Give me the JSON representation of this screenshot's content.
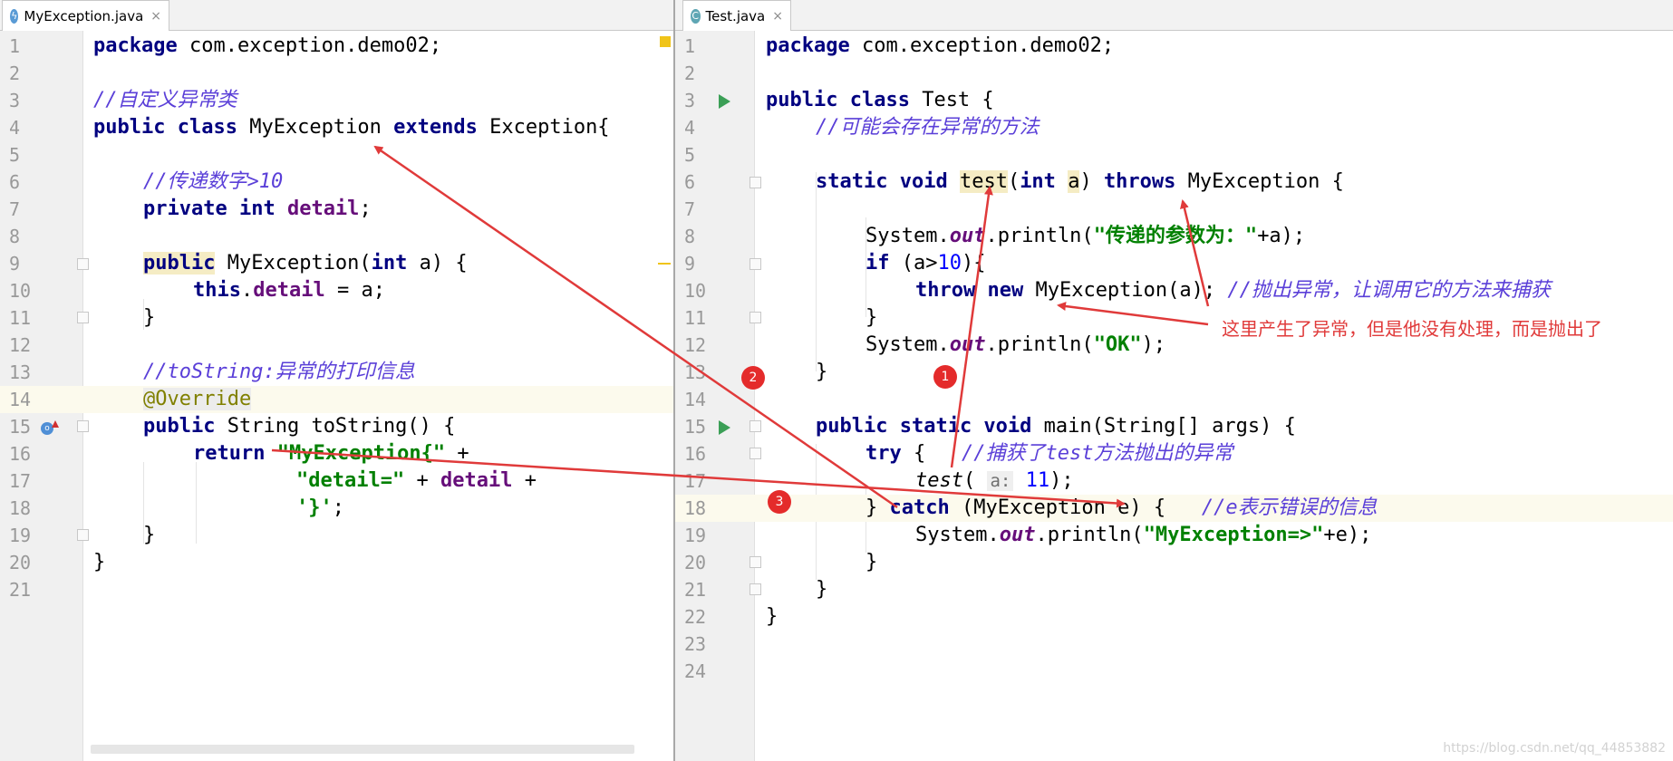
{
  "left_tab": {
    "label": "MyException.java",
    "icon": "exception-class-icon",
    "close": "×"
  },
  "right_tab": {
    "label": "Test.java",
    "icon": "class-icon",
    "close": "×"
  },
  "left_lines": [
    "1",
    "2",
    "3",
    "4",
    "5",
    "6",
    "7",
    "8",
    "9",
    "10",
    "11",
    "12",
    "13",
    "14",
    "15",
    "16",
    "17",
    "18",
    "19",
    "20",
    "21"
  ],
  "right_lines": [
    "1",
    "2",
    "3",
    "4",
    "5",
    "6",
    "7",
    "8",
    "9",
    "10",
    "11",
    "12",
    "13",
    "14",
    "15",
    "16",
    "17",
    "18",
    "19",
    "20",
    "21",
    "22",
    "23",
    "24"
  ],
  "left_code": {
    "l1_kw": "package",
    "l1_rest": " com.exception.demo02;",
    "l3_cm": "//自定义异常类",
    "l4_kw1": "public class",
    "l4_name": " MyException ",
    "l4_kw2": "extends",
    "l4_rest": " Exception{",
    "l6_cm": "//传递数字>10",
    "l7_kw": "private int",
    "l7_sp": " ",
    "l7_fld": "detail",
    "l7_end": ";",
    "l9_kw1": "public",
    "l9_mid": " MyException(",
    "l9_kw2": "int",
    "l9_end": " a) {",
    "l10_kw": "this",
    "l10_dot": ".",
    "l10_fld": "detail",
    "l10_end": " = a;",
    "l11": "}",
    "l13_cm": "//toString:异常的打印信息",
    "l14_ann": "@Override",
    "l15_kw": "public",
    "l15_rest": " String toString() {",
    "l16_kw": "return",
    "l16_sp": " ",
    "l16_st": "\"MyException{\"",
    "l16_end": " +",
    "l17_st": "\"detail=\"",
    "l17_mid": " + ",
    "l17_fld": "detail",
    "l17_end": " +",
    "l18_st": "'}'",
    "l18_end": ";",
    "l19": "}",
    "l20": "}"
  },
  "right_code": {
    "l1_kw": "package",
    "l1_rest": " com.exception.demo02;",
    "l3_kw": "public class",
    "l3_rest": " Test {",
    "l4_cm": "//可能会存在异常的方法",
    "l6_kw1": "static void",
    "l6_sp": " ",
    "l6_method": "test",
    "l6_p1": "(",
    "l6_kw2": "int",
    "l6_sp2": " ",
    "l6_a": "a",
    "l6_p2": ") ",
    "l6_kw3": "throws",
    "l6_rest": " MyException {",
    "l8_a": "System.",
    "l8_out": "out",
    "l8_b": ".println(",
    "l8_st": "\"传递的参数为：\"",
    "l8_end": "+a);",
    "l9_kw": "if",
    "l9_a": " (a>",
    "l9_num": "10",
    "l9_end": "){",
    "l10_kw": "throw new",
    "l10_rest": " MyException(a); ",
    "l10_cm": "//抛出异常，让调用它的方法来捕获",
    "l11": "}",
    "l12_a": "System.",
    "l12_out": "out",
    "l12_b": ".println(",
    "l12_st": "\"OK\"",
    "l12_end": ");",
    "l13": "}",
    "l15_kw": "public static void",
    "l15_rest": " main(String[] args) {",
    "l16_kw": "try",
    "l16_rest": " {   ",
    "l16_cm": "//捕获了test方法抛出的异常",
    "l17_call": "test",
    "l17_p": "( ",
    "l17_hint": "a:",
    "l17_num": " 11",
    "l17_end": ");",
    "l18_a": "} ",
    "l18_kw": "catch",
    "l18_rest": " (MyException e) {   ",
    "l18_cm": "//e表示错误的信息",
    "l19_a": "System.",
    "l19_out": "out",
    "l19_b": ".println(",
    "l19_st": "\"MyException=>\"",
    "l19_end": "+e);",
    "l20": "}",
    "l21": "}",
    "l22": "}"
  },
  "annotations": {
    "note": "这里产生了异常，但是他没有处理，而是抛出了",
    "badge1": "1",
    "badge2": "2",
    "badge3": "3",
    "color": "#e03a3a"
  },
  "watermark": "https://blog.csdn.net/qq_44853882"
}
